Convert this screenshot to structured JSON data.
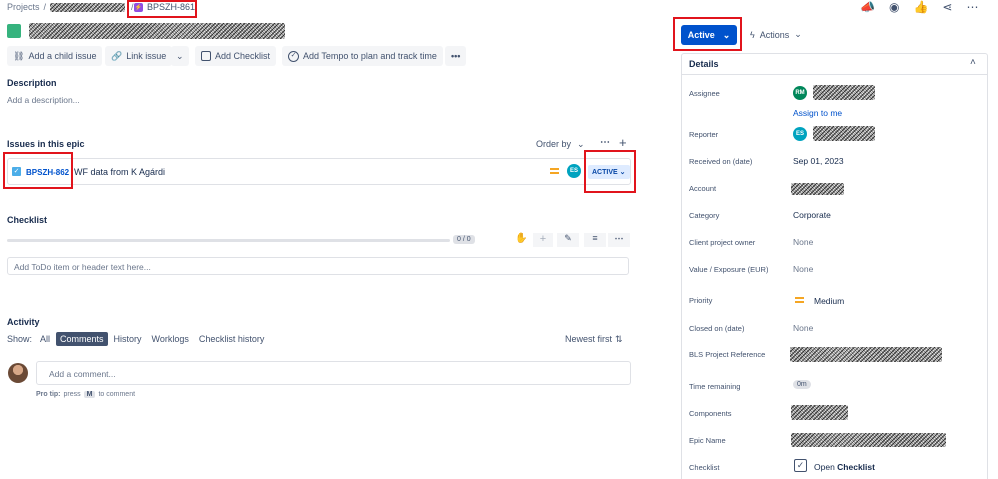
{
  "breadcrumb": {
    "projects": "Projects",
    "sep": "/",
    "issue_key": "BPSZH-861"
  },
  "toolbar": {
    "add_child": "Add a child issue",
    "link_issue": "Link issue",
    "add_checklist": "Add Checklist",
    "add_tempo": "Add Tempo to plan and track time"
  },
  "description": {
    "heading": "Description",
    "placeholder": "Add a description..."
  },
  "epic": {
    "heading": "Issues in this epic",
    "order_by": "Order by",
    "child": {
      "key": "BPSZH-862",
      "summary": "WF data from K Agárdi",
      "assignee_initials": "ES",
      "status": "ACTIVE"
    }
  },
  "checklist": {
    "heading": "Checklist",
    "progress": "0 / 0",
    "progress_fraction": 0,
    "input_placeholder": "Add ToDo item or header text here..."
  },
  "activity": {
    "heading": "Activity",
    "show_label": "Show:",
    "tabs": [
      "All",
      "Comments",
      "History",
      "Worklogs",
      "Checklist history"
    ],
    "active_tab": "Comments",
    "sort": "Newest first",
    "comment_placeholder": "Add a comment...",
    "pro_tip_label": "Pro tip:",
    "pro_tip_press": "press",
    "pro_tip_key": "M",
    "pro_tip_rest": "to comment"
  },
  "status_button": {
    "label": "Active"
  },
  "actions": {
    "label": "Actions"
  },
  "details": {
    "heading": "Details",
    "assignee_label": "Assignee",
    "assignee_initials": "RM",
    "assign_to_me": "Assign to me",
    "reporter_label": "Reporter",
    "reporter_initials": "ES",
    "received_label": "Received on (date)",
    "received_value": "Sep 01, 2023",
    "account_label": "Account",
    "category_label": "Category",
    "category_value": "Corporate",
    "client_owner_label": "Client project owner",
    "client_owner_value": "None",
    "value_label": "Value / Exposure (EUR)",
    "value_value": "None",
    "priority_label": "Priority",
    "priority_value": "Medium",
    "closed_label": "Closed on (date)",
    "closed_value": "None",
    "bls_label": "BLS Project Reference",
    "time_label": "Time remaining",
    "time_value": "0m",
    "components_label": "Components",
    "epic_name_label": "Epic Name",
    "checklist_label": "Checklist",
    "checklist_open": "Open",
    "checklist_word": "Checklist"
  },
  "colors": {
    "primary": "#0052cc",
    "epic": "#36b37e",
    "flag": "#e1141c",
    "status_bg": "#deebff",
    "medium": "#f5a623",
    "avatar_rm": "#00875a",
    "avatar_es": "#00a3bf"
  }
}
